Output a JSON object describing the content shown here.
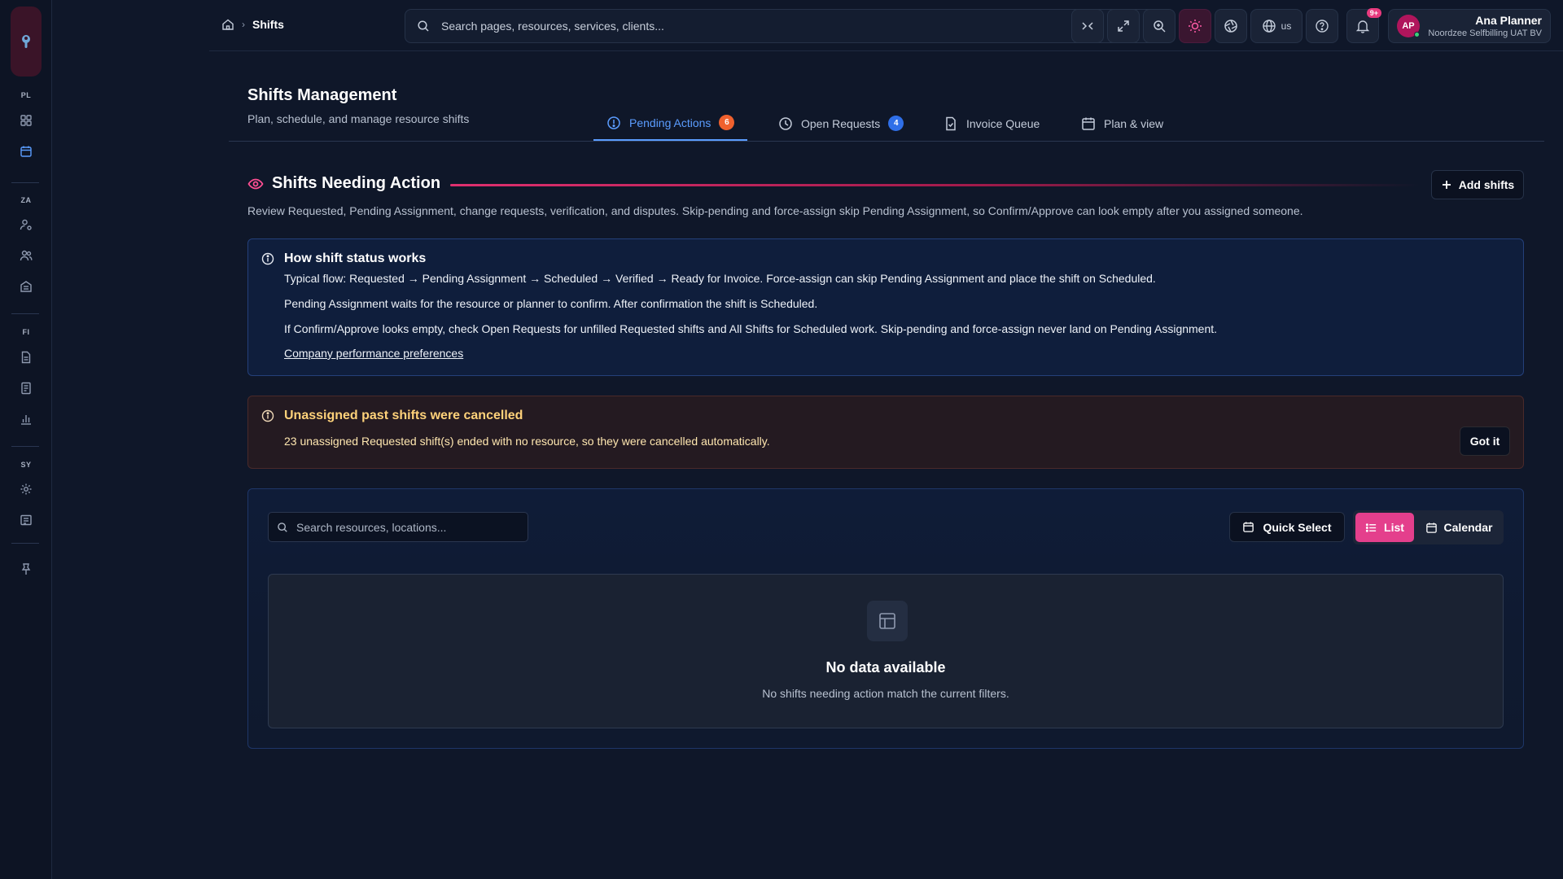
{
  "sidebar": {
    "sections": [
      "PL",
      "ZA",
      "FI",
      "SY"
    ]
  },
  "topbar": {
    "breadcrumb_current": "Shifts",
    "search_placeholder": "Search pages, resources, services, clients...",
    "language": "us",
    "notifications_badge": "9+",
    "user": {
      "initials": "AP",
      "name": "Ana Planner",
      "org": "Noordzee Selfbilling UAT BV"
    }
  },
  "page": {
    "title": "Shifts Management",
    "subtitle": "Plan, schedule, and manage resource shifts",
    "tabs": [
      {
        "label": "Pending Actions",
        "count": "6",
        "count_color": "#f0612e"
      },
      {
        "label": "Open Requests",
        "count": "4",
        "count_color": "#2f6fe8"
      },
      {
        "label": "Invoice Queue"
      },
      {
        "label": "Plan & view"
      }
    ]
  },
  "section": {
    "title": "Shifts Needing Action",
    "add_button": "Add shifts",
    "description": "Review Requested, Pending Assignment, change requests, verification, and disputes. Skip-pending and force-assign skip Pending Assignment, so Confirm/Approve can look empty after you assigned someone."
  },
  "info_box": {
    "title": "How shift status works",
    "lines": [
      "Typical flow: Requested → Pending Assignment → Scheduled → Verified → Ready for Invoice. Force-assign can skip Pending Assignment and place the shift on Scheduled.",
      "Pending Assignment waits for the resource or planner to confirm. After confirmation the shift is Scheduled.",
      "If Confirm/Approve looks empty, check Open Requests for unfilled Requested shifts and All Shifts for Scheduled work. Skip-pending and force-assign never land on Pending Assignment."
    ],
    "link": "Company performance preferences"
  },
  "warning_box": {
    "title": "Unassigned past shifts were cancelled",
    "text": "23 unassigned Requested shift(s) ended with no resource, so they were cancelled automatically.",
    "button": "Got it"
  },
  "panel": {
    "search_placeholder": "Search resources, locations...",
    "quick_select": "Quick Select",
    "view_list": "List",
    "view_calendar": "Calendar",
    "empty_title": "No data available",
    "empty_desc": "No shifts needing action match the current filters."
  }
}
